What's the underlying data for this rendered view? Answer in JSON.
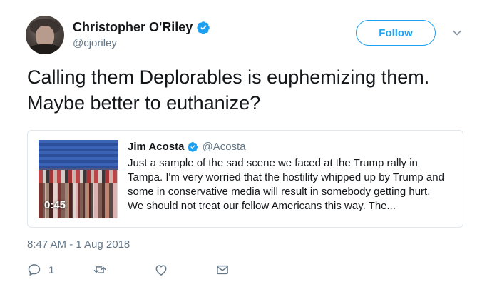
{
  "author": {
    "name": "Christopher O'Riley",
    "handle": "@cjoriley",
    "verified_icon": "verified-badge-icon"
  },
  "follow_label": "Follow",
  "tweet_text": "Calling them Deplorables is euphemizing them. Maybe better to euthanize?",
  "quoted": {
    "name": "Jim Acosta",
    "handle": "@Acosta",
    "video_duration": "0:45",
    "text": "Just a sample of the sad scene we faced at the Trump rally in Tampa. I'm very worried that the hostility whipped up by Trump and some in conservative media will result in somebody getting hurt. We should not treat our fellow Americans this way. The..."
  },
  "timestamp": "8:47 AM - 1 Aug 2018",
  "actions": {
    "reply_count": "1"
  },
  "colors": {
    "accent": "#1da1f2",
    "secondary_text": "#657786",
    "border": "#e1e8ed"
  }
}
